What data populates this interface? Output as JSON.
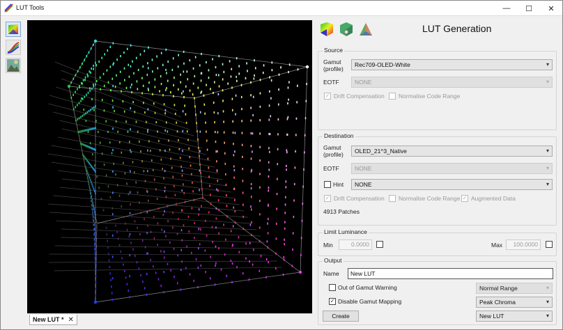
{
  "window": {
    "title": "LUT Tools",
    "controls": {
      "minimize": "—",
      "maximize": "☐",
      "close": "✕"
    }
  },
  "toolstrip": {
    "tools": [
      "gamut-3d-tool-icon",
      "curves-tool-icon",
      "image-tool-icon"
    ]
  },
  "viewport": {
    "tab_label": "New LUT *",
    "tab_close": "✕"
  },
  "panel": {
    "title": "LUT Generation",
    "source": {
      "label": "Source",
      "gamut_label_1": "Gamut",
      "gamut_label_2": "(profile)",
      "gamut_value": "Rec709-OLED-White",
      "eotf_label": "EOTF",
      "eotf_value": "NONE",
      "drift_label": "Drift Compensation",
      "normalise_label": "Normalise Code Range"
    },
    "destination": {
      "label": "Destination",
      "gamut_label_1": "Gamut",
      "gamut_label_2": "(profile)",
      "gamut_value": "OLED_21^3_Native",
      "eotf_label": "EOTF",
      "eotf_value": "NONE",
      "hint_label": "Hint",
      "hint_value": "NONE",
      "drift_label": "Drift Compensation",
      "normalise_label": "Normalise Code Range",
      "augmented_label": "Augmented Data",
      "patches_text": "4913 Patches"
    },
    "limit": {
      "label": "Limit Luminance",
      "min_label": "Min",
      "min_value": "0.0000",
      "max_label": "Max",
      "max_value": "100.0000"
    },
    "output": {
      "label": "Output",
      "name_label": "Name",
      "name_value": "New LUT",
      "oog_label": "Out of Gamut Warning",
      "range_value": "Normal Range",
      "disable_label": "Disable Gamut Mapping",
      "mapping_value": "Peak Chroma",
      "create_label": "Create",
      "target_value": "New LUT"
    }
  },
  "colors": {
    "viewport_bg": "#000000",
    "window_bg": "#f0f0f0",
    "corner_white": "#ffffff",
    "corner_green": "#22cc44",
    "corner_cyan": "#33dddd",
    "corner_blue": "#2244ff",
    "corner_magenta": "#ff33ff"
  }
}
